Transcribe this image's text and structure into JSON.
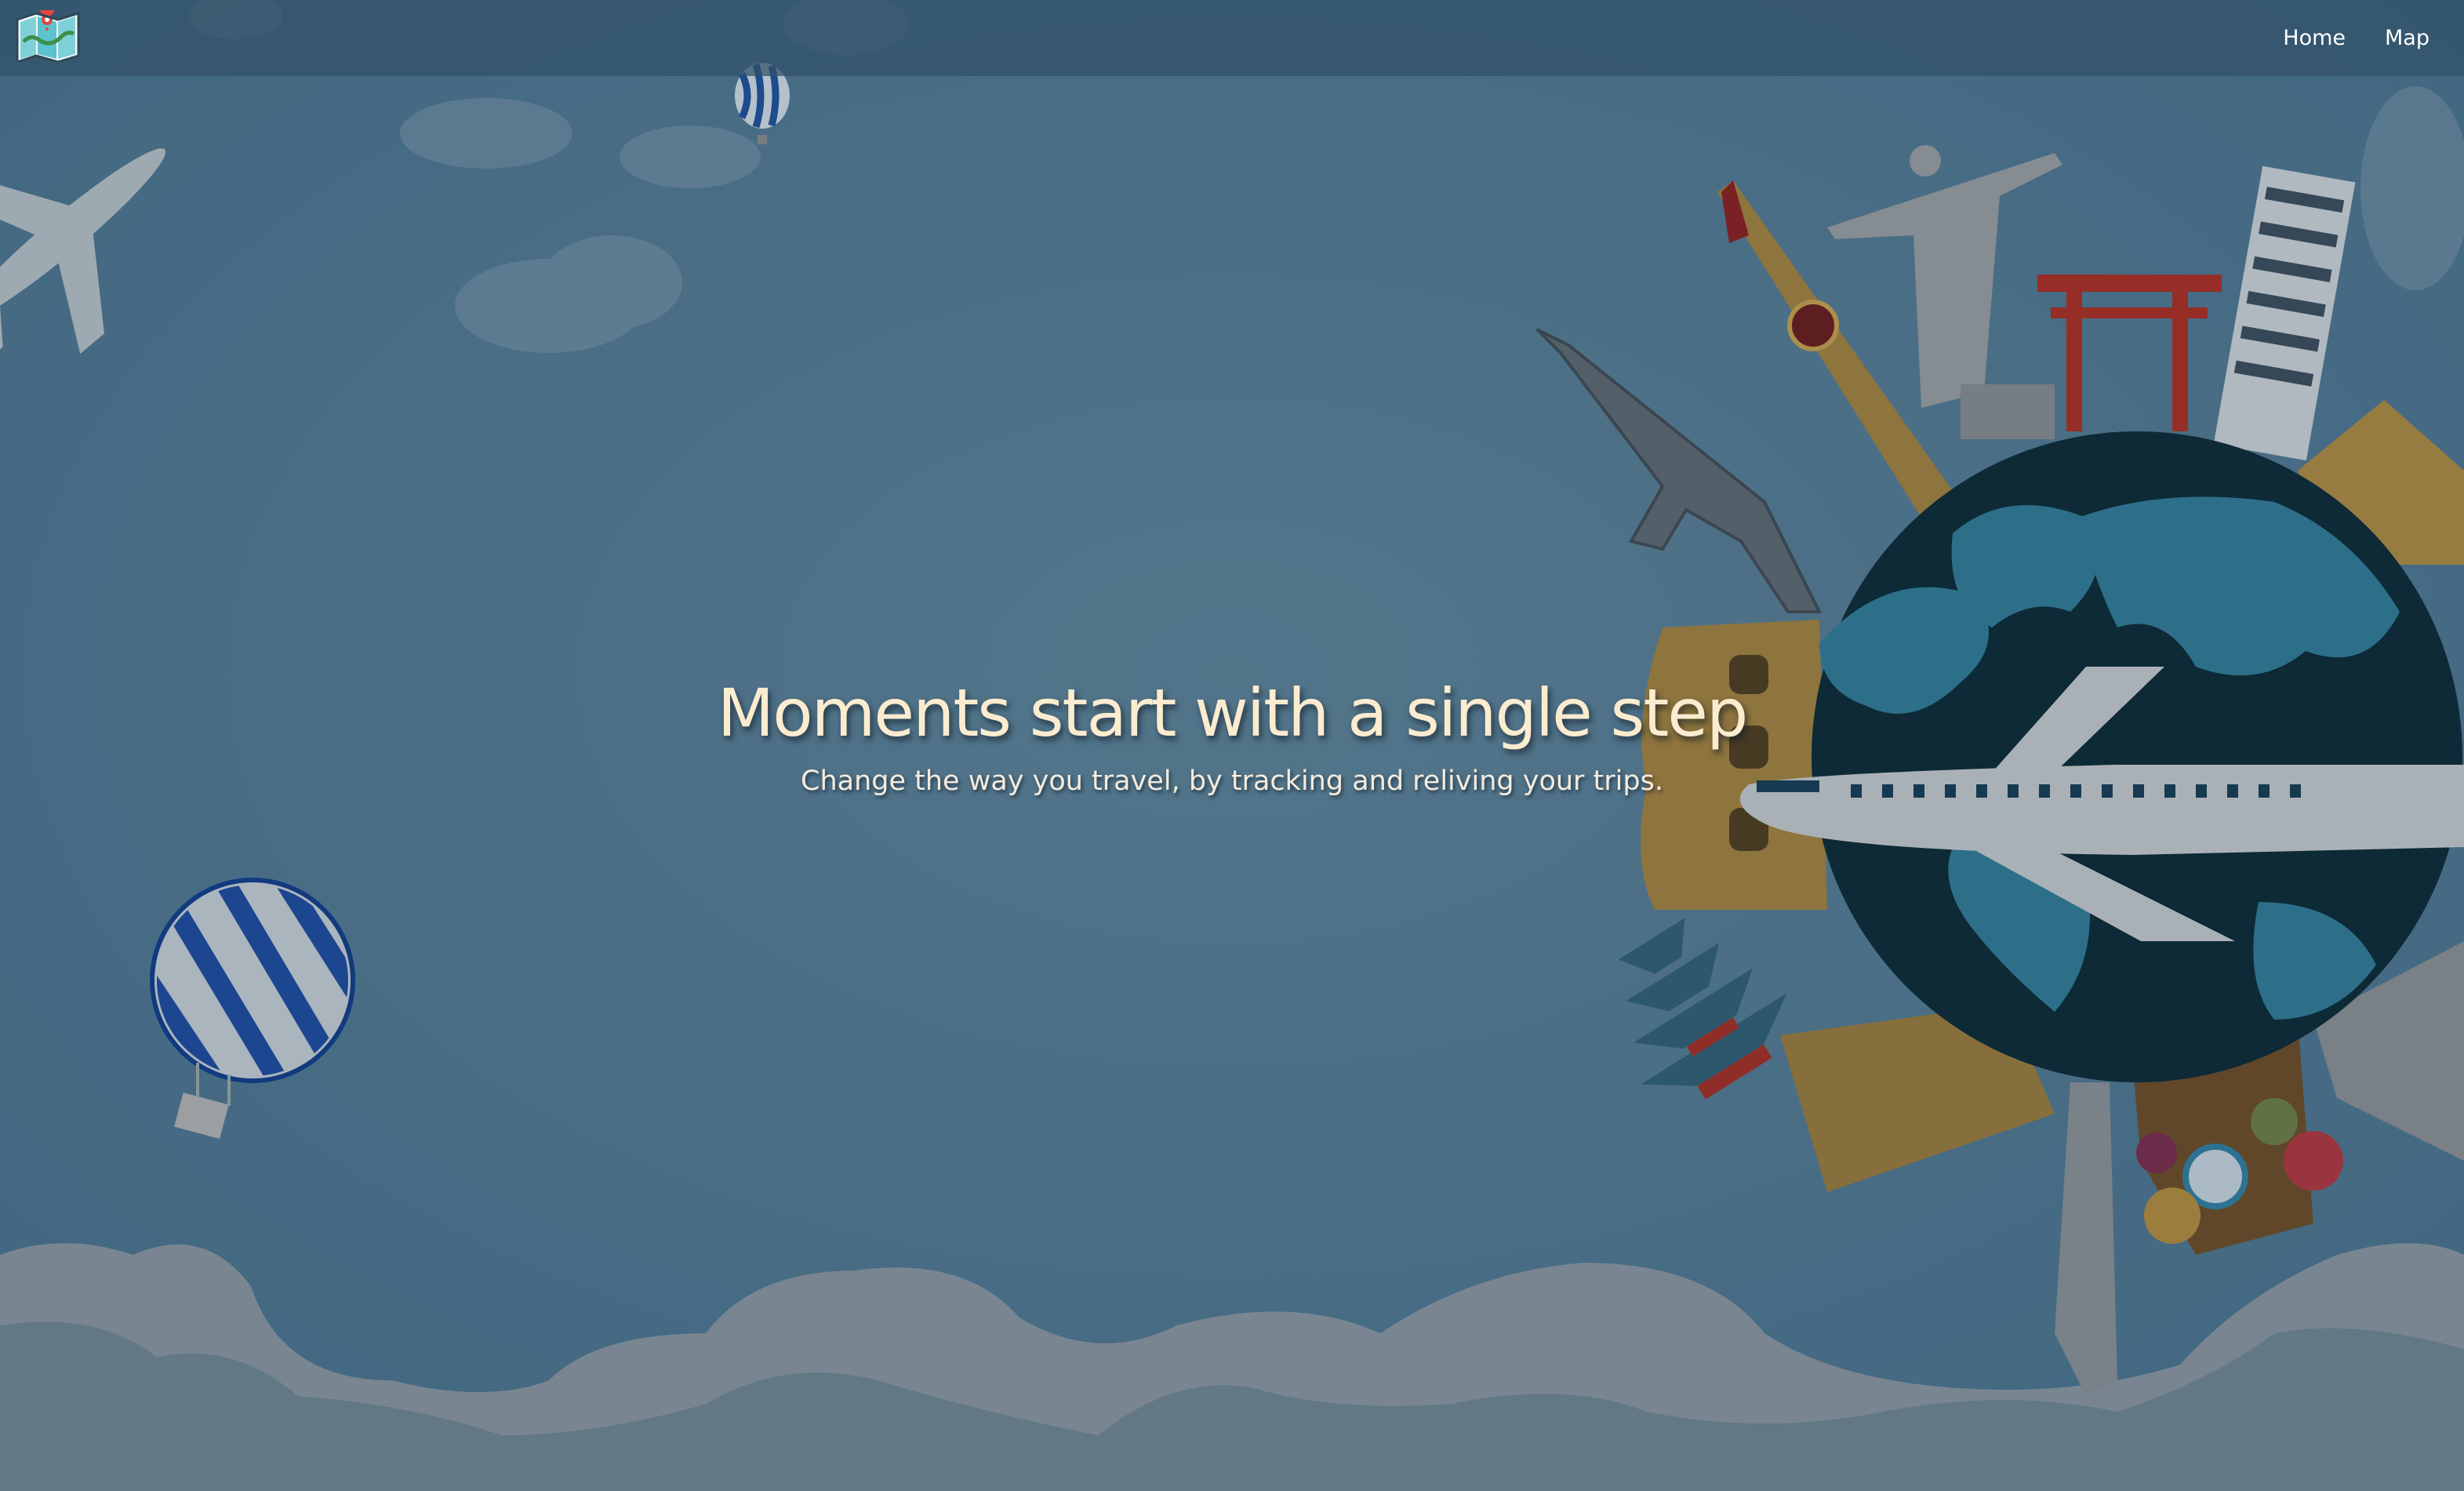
{
  "navbar": {
    "logo_icon": "folded-map-icon",
    "links": [
      {
        "label": "Home"
      },
      {
        "label": "Map"
      }
    ]
  },
  "hero": {
    "title": "Moments start with a single step",
    "subtitle": "Change the way you travel, by tracking and reliving your trips."
  },
  "background": {
    "sky_color": "#4d7690",
    "cloud_color": "#7f8e96",
    "globe_ocean_color": "#082631",
    "globe_land_color": "#2f7a96",
    "title_color": "#fbecd0",
    "illustration_items": [
      "airplane-icon",
      "hot-air-balloon-icon",
      "globe-icon",
      "landmarks-illustration"
    ]
  }
}
